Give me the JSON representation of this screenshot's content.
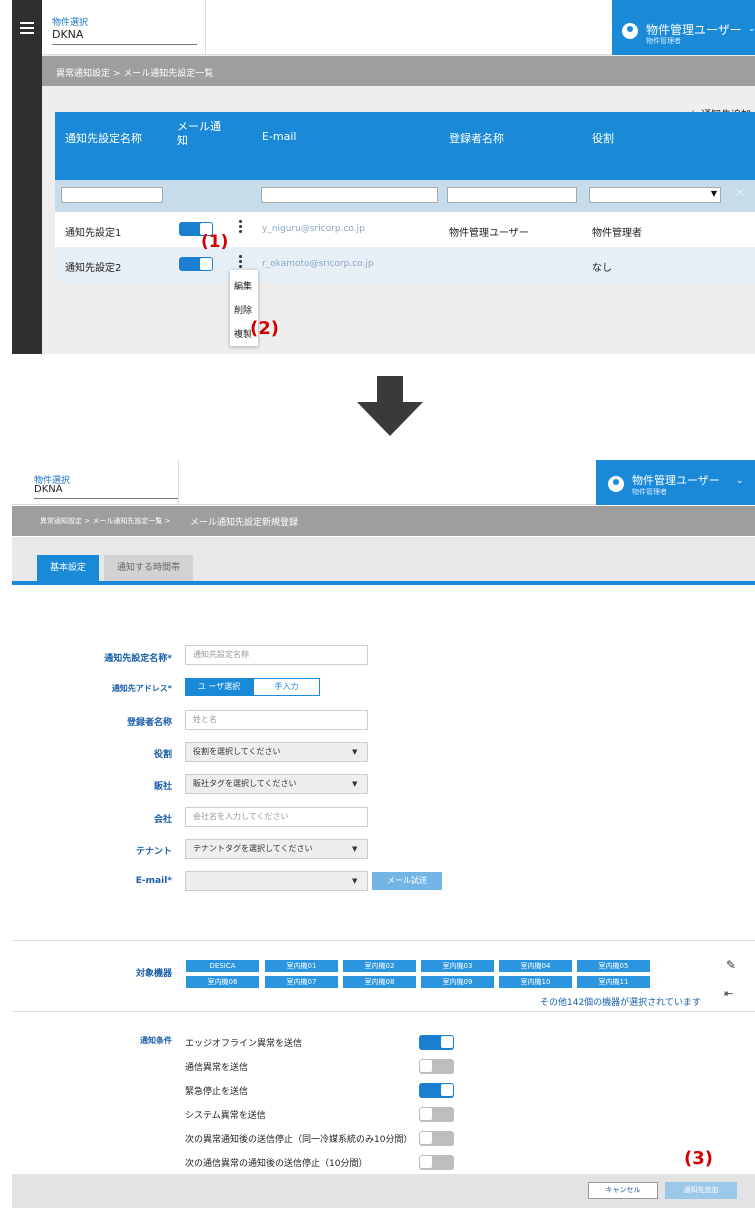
{
  "screen1": {
    "property_label": "物件選択",
    "property_value": "DKNA",
    "user_name": "物件管理ユーザー",
    "user_role": "物件管理者",
    "breadcrumb": "異常通知設定 > メール通知先設定一覧",
    "add_button": "＋ 通知先追加",
    "columns": [
      "通知先設定名称",
      "メール通\n知",
      "E-mail",
      "登録者名称",
      "役割"
    ],
    "rows": [
      {
        "name": "通知先設定1",
        "email": "y_niguru@sricorp.co.jp",
        "registrant": "物件管理ユーザー",
        "role": "物件管理者"
      },
      {
        "name": "通知先設定2",
        "email": "r_okamoto@sricorp.co.jp",
        "registrant": "",
        "role": "なし"
      }
    ],
    "menu": [
      "編集",
      "削除",
      "複製"
    ],
    "callout1": "(1)",
    "callout2": "(2)"
  },
  "screen2": {
    "property_label": "物件選択",
    "property_value": "DKNA",
    "user_name": "物件管理ユーザー",
    "user_role": "物件管理者",
    "breadcrumb_prefix": "異常通知設定 > メール通知先設定一覧 >",
    "breadcrumb_current": "メール通知先設定新規登録",
    "tabs": [
      "基本設定",
      "通知する時間帯"
    ],
    "form": {
      "name_label": "通知先設定名称*",
      "name_placeholder": "通知先設定名称",
      "address_label": "通知先アドレス*",
      "address_option_user": "ユ ーザ選択",
      "address_option_manual": "手入力",
      "registrant_label": "登録者名称",
      "registrant_placeholder": "姓と名",
      "role_label": "役割",
      "role_value": "役割を選択してください",
      "dealer_label": "販社",
      "dealer_value": "販社タグを選択してください",
      "company_label": "会社",
      "company_placeholder": "会社名を入力してください",
      "tenant_label": "テナント",
      "tenant_value": "テナントタグを選択してください",
      "email_label": "E-mail*",
      "email_test_button": "メール試送"
    },
    "devices_label": "対象機器",
    "devices": [
      "DESICA",
      "室内機01",
      "室内機02",
      "室内機03",
      "室内機04",
      "室内機05",
      "室内機06",
      "室内機07",
      "室内機08",
      "室内機09",
      "室内機10",
      "室内機11"
    ],
    "devices_more": "その他142個の機器が選択されています",
    "conditions_label": "通知条件",
    "conditions": [
      {
        "label": "エッジオフライン異常を送信",
        "on": true
      },
      {
        "label": "通信異常を送信",
        "on": false
      },
      {
        "label": "緊急停止を送信",
        "on": true
      },
      {
        "label": "システム異常を送信",
        "on": false
      },
      {
        "label": "次の異常通知後の送信停止（同一冷媒系統のみ10分間）",
        "on": false
      },
      {
        "label": "次の通信異常の通知後の送信停止（10分間）",
        "on": false
      }
    ],
    "cancel_button": "キャンセル",
    "submit_button": "通知先追加",
    "callout3": "(3)"
  },
  "colors": {
    "accent": "#1a8ad8",
    "callout": "#d40000",
    "rail": "#2f2f2f"
  },
  "icons": [
    "hamburger-icon",
    "user-icon",
    "chevron-down-icon",
    "kebab-icon",
    "close-icon",
    "down-arrow-icon",
    "pencil-icon",
    "exit-icon"
  ]
}
